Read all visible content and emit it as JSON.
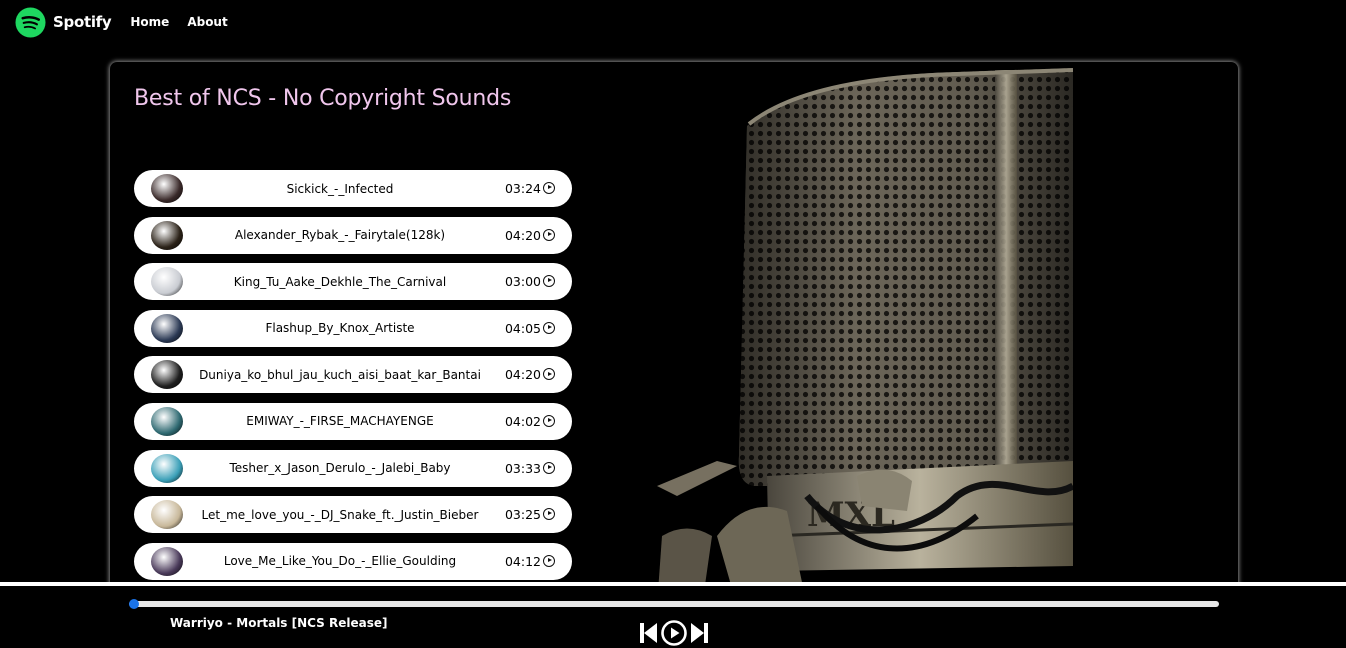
{
  "navbar": {
    "brand": "Spotify",
    "links": [
      "Home",
      "About"
    ]
  },
  "playlist": {
    "title": "Best of NCS - No Copyright Sounds",
    "songs": [
      {
        "name": "Sickick_-_Infected",
        "duration": "03:24",
        "thumb_color": "#3a2a2a"
      },
      {
        "name": "Alexander_Rybak_-_Fairytale(128k)",
        "duration": "04:20",
        "thumb_color": "#2b2218"
      },
      {
        "name": "King_Tu_Aake_Dekhle_The_Carnival",
        "duration": "03:00",
        "thumb_color": "#c9ccd2"
      },
      {
        "name": "Flashup_By_Knox_Artiste",
        "duration": "04:05",
        "thumb_color": "#2c3a55"
      },
      {
        "name": "Duniya_ko_bhul_jau_kuch_aisi_baat_kar_Bantai",
        "duration": "04:20",
        "thumb_color": "#1e1e1e"
      },
      {
        "name": "EMIWAY_-_FIRSE_MACHAYENGE",
        "duration": "04:02",
        "thumb_color": "#2f6a72"
      },
      {
        "name": "Tesher_x_Jason_Derulo_-_Jalebi_Baby",
        "duration": "03:33",
        "thumb_color": "#3ba0b8"
      },
      {
        "name": "Let_me_love_you_-_DJ_Snake_ft._Justin_Bieber",
        "duration": "03:25",
        "thumb_color": "#c8b89a"
      },
      {
        "name": "Love_Me_Like_You_Do_-_Ellie_Goulding",
        "duration": "04:12",
        "thumb_color": "#4a3a5a"
      }
    ]
  },
  "player": {
    "now_playing": "Warriyo - Mortals [NCS Release]",
    "progress_fraction": 0.0
  },
  "icons": {
    "play": "play-circle-icon",
    "previous": "previous-icon",
    "next": "next-icon"
  },
  "colors": {
    "title": "#f0c6ec",
    "brand_green": "#1ed760",
    "progress_knob": "#1a73e8"
  }
}
